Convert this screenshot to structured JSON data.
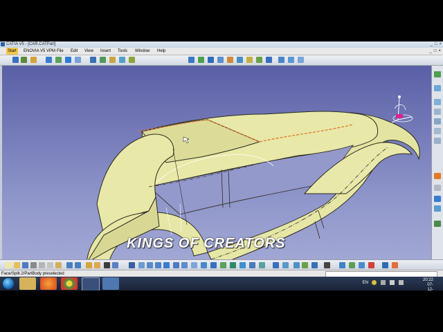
{
  "window": {
    "title": "CATIA V5 - [CAR.CATPart]",
    "controls": [
      "_",
      "□",
      "×"
    ]
  },
  "menu": {
    "items": [
      "Start",
      "ENOVIA V5 VPM",
      "File",
      "Edit",
      "View",
      "Insert",
      "Tools",
      "Window",
      "Help"
    ],
    "window_controls": [
      "_",
      "□",
      "×"
    ]
  },
  "watermark": "KINGS OF CREATORS",
  "status": {
    "text": "Face/Split.2/PartBody preselected"
  },
  "taskbar": {
    "lang": "EN",
    "time": "20:22",
    "date": "07-12-2017"
  },
  "colors": {
    "viewport_top": "#5a5fa6",
    "viewport_bottom": "#a9aed8",
    "model_fill": "#e6e6a6",
    "accent": "#f3c74d"
  }
}
